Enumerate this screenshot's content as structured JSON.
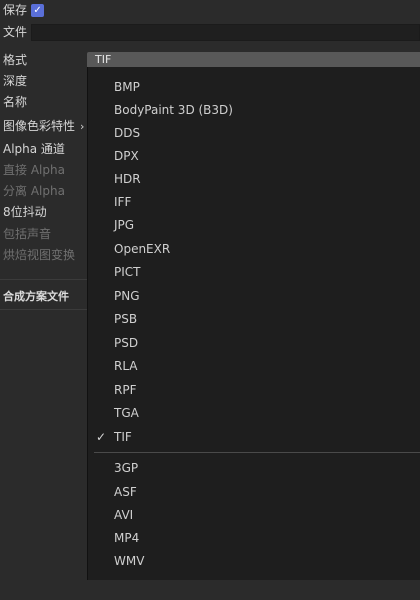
{
  "settings": {
    "save_label": "保存",
    "save_checked": true,
    "file_label": "文件",
    "file_value": "",
    "format_label": "格式",
    "depth_label": "深度",
    "name_label": "名称",
    "image_color_label": "图像色彩特性",
    "alpha_channel_label": "Alpha 通道",
    "straight_alpha_label": "直接 Alpha",
    "separate_alpha_label": "分离 Alpha",
    "dither_label": "8位抖动",
    "include_sound_label": "包括声音",
    "bake_view_label": "烘焙视图变换",
    "compositing_label": "合成方案文件"
  },
  "format_select": {
    "value": "TIF"
  },
  "dropdown": {
    "image_formats": [
      "BMP",
      "BodyPaint 3D (B3D)",
      "DDS",
      "DPX",
      "HDR",
      "IFF",
      "JPG",
      "OpenEXR",
      "PICT",
      "PNG",
      "PSB",
      "PSD",
      "RLA",
      "RPF",
      "TGA",
      "TIF"
    ],
    "video_formats": [
      "3GP",
      "ASF",
      "AVI",
      "MP4",
      "WMV"
    ],
    "selected": "TIF"
  },
  "colors": {
    "background": "#2b2b2b",
    "accent": "#5a6fd8",
    "dropdown_bg": "#1e1e1e"
  }
}
